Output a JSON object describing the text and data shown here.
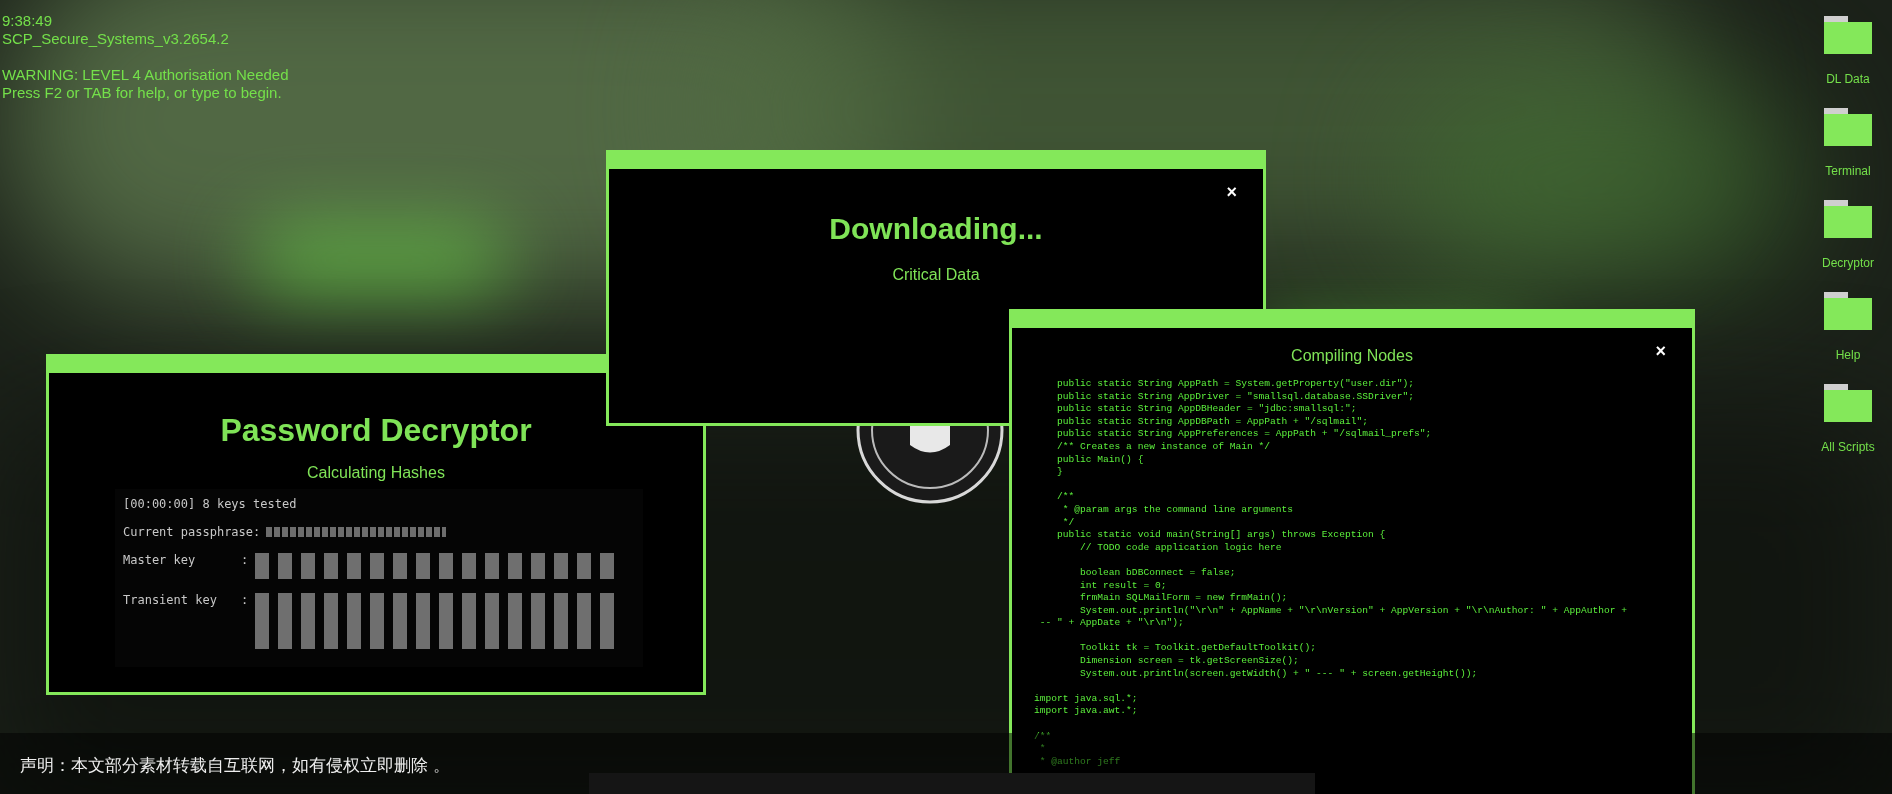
{
  "status_text": {
    "time": "9:38:49",
    "system": "SCP_Secure_Systems_v3.2654.2",
    "warning": "WARNING: LEVEL 4 Authorisation Needed",
    "hint": "Press F2 or TAB for help, or type to begin."
  },
  "desktop_icons": [
    {
      "label": "DL Data"
    },
    {
      "label": "Terminal"
    },
    {
      "label": "Decryptor"
    },
    {
      "label": "Help"
    },
    {
      "label": "All Scripts"
    }
  ],
  "windows": [
    {
      "kind": "decryptor",
      "title": "Password Decryptor",
      "subtitle": "Calculating Hashes",
      "log": {
        "progress": "[00:00:00] 8 keys tested",
        "passphrase_label": "Current passphrase:",
        "master_key": {
          "label": "Master key",
          "separator": ":"
        },
        "transient_key": {
          "label": "Transient key",
          "separator": ":"
        }
      }
    },
    {
      "kind": "download",
      "title": "Downloading...",
      "subtitle": "Critical Data",
      "close": "×"
    },
    {
      "kind": "code",
      "title": "Compiling Nodes",
      "close": "×",
      "code_blocks": [
        [
          "    public static String AppPath = System.getProperty(\"user.dir\");",
          "    public static String AppDriver = \"smallsql.database.SSDriver\";",
          "    public static String AppDBHeader = \"jdbc:smallsql:\";",
          "    public static String AppDBPath = AppPath + \"/sqlmail\";",
          "    public static String AppPreferences = AppPath + \"/sqlmail_prefs\";",
          "    /** Creates a new instance of Main */",
          "    public Main() {",
          "    }"
        ],
        [
          "    /**",
          "     * @param args the command line arguments",
          "     */",
          "    public static void main(String[] args) throws Exception {",
          "        // TODO code application logic here"
        ],
        [
          "        boolean bDBConnect = false;",
          "        int result = 0;",
          "        frmMain SQLMailForm = new frmMain();",
          "        System.out.println(\"\\r\\n\" + AppName + \"\\r\\nVersion\" + AppVersion + \"\\r\\nAuthor: \" + AppAuthor +",
          " -- \" + AppDate + \"\\r\\n\");"
        ],
        [
          "        Toolkit tk = Toolkit.getDefaultToolkit();",
          "        Dimension screen = tk.getScreenSize();",
          "        System.out.println(screen.getWidth() + \" --- \" + screen.getHeight());"
        ],
        [
          "import java.sql.*;",
          "import java.awt.*;"
        ],
        [
          "/**",
          " *",
          " * @author jeff"
        ]
      ]
    }
  ],
  "notice_bar": {
    "text": "声明：本文部分素材转载自互联网，如有侵权立即删除 。"
  }
}
